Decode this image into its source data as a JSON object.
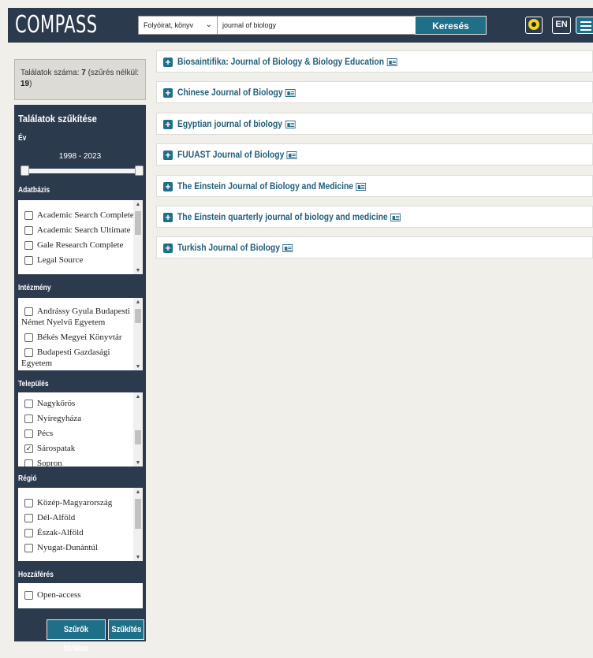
{
  "header": {
    "logo": "COMPASS",
    "type_select": "Folyóirat, könyv",
    "search_value": "journal of biology",
    "search_button": "Keresés",
    "lang_button": "EN"
  },
  "count": {
    "label": "Találatok száma: ",
    "value": "7",
    "suffix": " (szűrés nélkül: ",
    "total": "19",
    "close": ")"
  },
  "sidebar": {
    "title": "Találatok szűkítése",
    "year_label": "Év",
    "year_range": "1998 - 2023",
    "database_label": "Adatbázis",
    "databases": [
      "Academic Search Complete",
      "Academic Search Ultimate",
      "Gale Research Complete",
      "Legal Source"
    ],
    "institution_label": "Intézmény",
    "institutions": [
      "Andrássy Gyula Budapesti Német Nyelvű Egyetem",
      "Békés Megyei Könyvtár",
      "Budapesti Gazdasági Egyetem"
    ],
    "city_label": "Település",
    "cities": [
      {
        "name": "Nagykőrös",
        "checked": false
      },
      {
        "name": "Nyíregyháza",
        "checked": false
      },
      {
        "name": "Pécs",
        "checked": false
      },
      {
        "name": "Sárospatak",
        "checked": true
      },
      {
        "name": "Sopron",
        "checked": false
      }
    ],
    "region_label": "Régió",
    "regions": [
      "Közép-Magyarország",
      "Dél-Alföld",
      "Észak-Alföld",
      "Nyugat-Dunántúl"
    ],
    "access_label": "Hozzáférés",
    "access_options": [
      "Open-access"
    ],
    "clear_button": "Szűrők törlése",
    "apply_button": "Szűkítés"
  },
  "results": [
    "Biosaintifika: Journal of Biology & Biology Education",
    "Chinese Journal of Biology",
    "Egyptian journal of biology",
    "FUUAST Journal of Biology",
    "The Einstein Journal of Biology and Medicine",
    "The Einstein quarterly journal of biology and medicine",
    "Turkish Journal of Biology"
  ],
  "colors": {
    "header_bg": "#2c3a4d",
    "accent": "#1f6f88",
    "link": "#1f5f7a"
  }
}
